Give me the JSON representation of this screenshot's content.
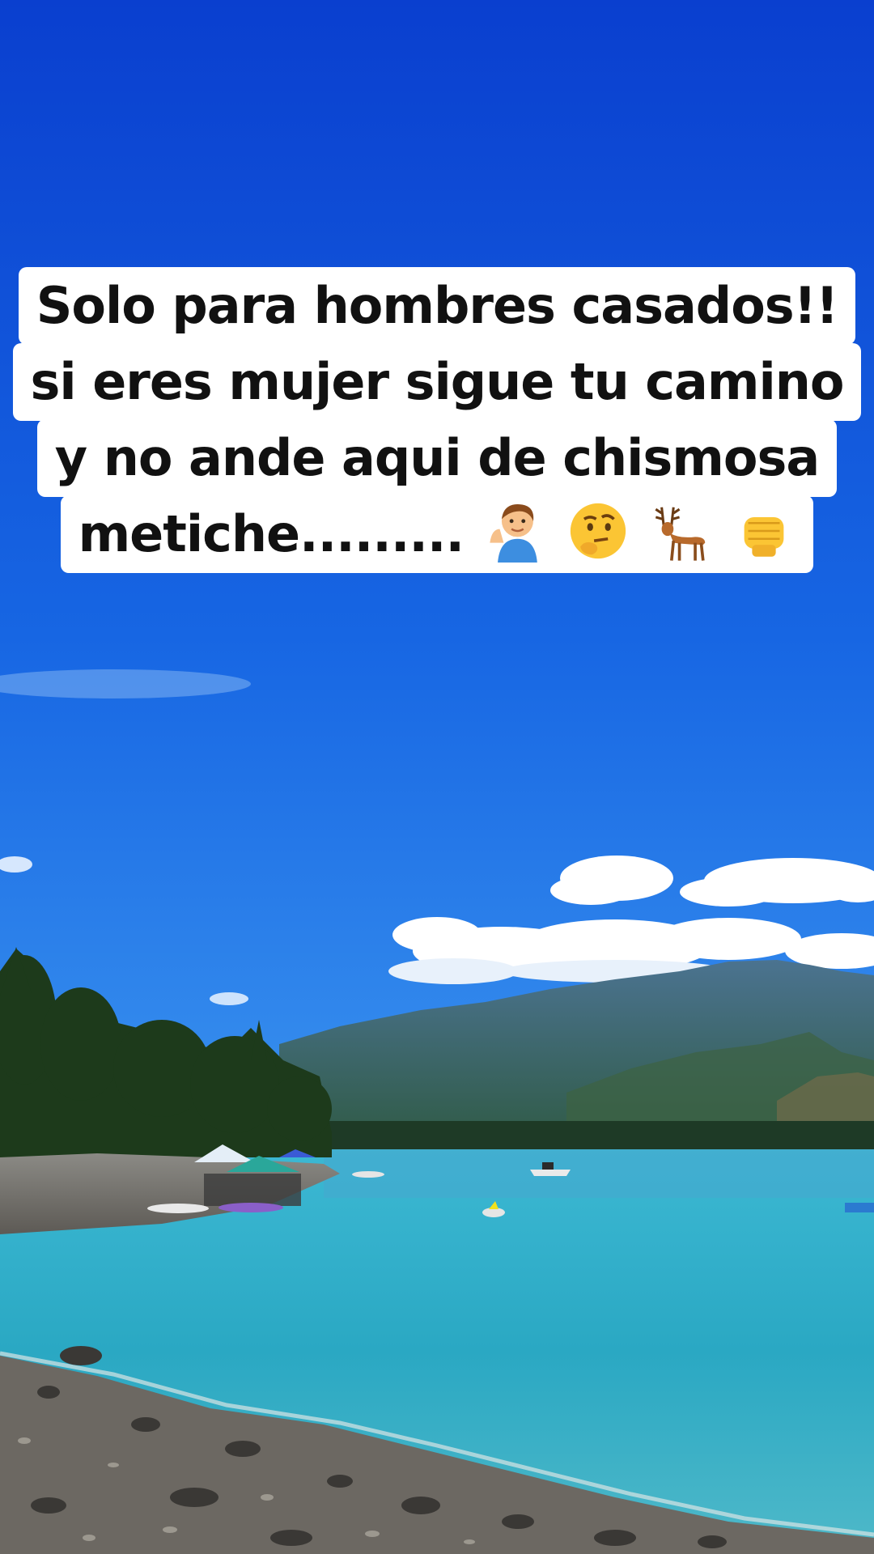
{
  "caption": {
    "lines": [
      "Solo para hombres casados!!",
      "si eres mujer sigue tu camino",
      "y no ande aqui de chismosa",
      "metiche........."
    ],
    "emojis": [
      "man-tipping-hand-icon",
      "thinking-face-icon",
      "deer-icon",
      "oncoming-fist-icon"
    ]
  },
  "colors": {
    "sky_top": "#0b46d6",
    "sky_bottom": "#2f86ea",
    "water": "#2eb0c8",
    "mountains": "#3f6a86",
    "trees": "#1f3a1c",
    "caption_bg": "#ffffff",
    "caption_text": "#111111"
  }
}
